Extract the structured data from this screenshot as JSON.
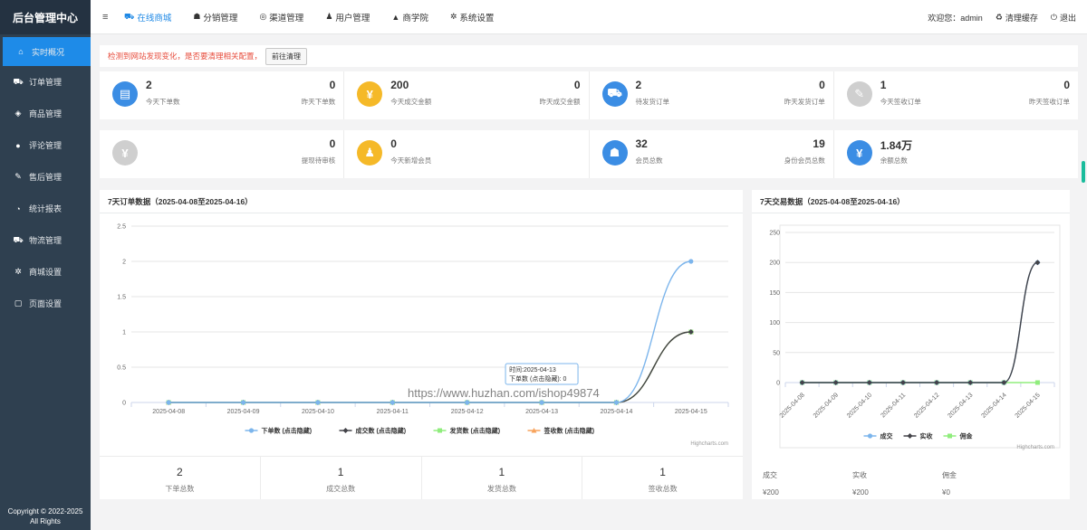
{
  "brand": "后台管理中心",
  "sidebar": {
    "items": [
      {
        "label": "实时概况",
        "icon": "home-icon",
        "glyph": "⌂",
        "active": true
      },
      {
        "label": "订单管理",
        "icon": "cart-icon",
        "glyph": "⛟",
        "active": false
      },
      {
        "label": "商品管理",
        "icon": "gift-icon",
        "glyph": "◈",
        "active": false
      },
      {
        "label": "评论管理",
        "icon": "comment-icon",
        "glyph": "●",
        "active": false
      },
      {
        "label": "售后管理",
        "icon": "gavel-icon",
        "glyph": "✎",
        "active": false
      },
      {
        "label": "统计报表",
        "icon": "pie-chart-icon",
        "glyph": "◔",
        "active": false
      },
      {
        "label": "物流管理",
        "icon": "truck-icon",
        "glyph": "⛟",
        "active": false
      },
      {
        "label": "商城设置",
        "icon": "gear-icon",
        "glyph": "✲",
        "active": false
      },
      {
        "label": "页面设置",
        "icon": "file-icon",
        "glyph": "▢",
        "active": false
      }
    ],
    "copyright_line1": "Copyright © 2022-2025",
    "copyright_line2": "All Rights"
  },
  "topnav": {
    "menu_icon": "≡",
    "items": [
      {
        "label": "在线商城",
        "icon": "cart-icon",
        "glyph": "⛟",
        "active": true
      },
      {
        "label": "分销管理",
        "icon": "users-icon",
        "glyph": "☗",
        "active": false
      },
      {
        "label": "渠道管理",
        "icon": "wechat-icon",
        "glyph": "◎",
        "active": false
      },
      {
        "label": "用户管理",
        "icon": "user-icon",
        "glyph": "♟",
        "active": false
      },
      {
        "label": "商学院",
        "icon": "graduation-cap-icon",
        "glyph": "▲",
        "active": false
      },
      {
        "label": "系统设置",
        "icon": "gear-icon",
        "glyph": "✲",
        "active": false
      }
    ],
    "welcome": "欢迎您：admin",
    "clear_cache": "清理缓存",
    "logout": "退出"
  },
  "alert": {
    "text": "检测到网站发现变化，是否要清理相关配置，",
    "button": "前往清理"
  },
  "stats_row1": [
    {
      "icon": "file-icon",
      "glyph": "▤",
      "color": "#3b8de4",
      "value": "2",
      "label": "今天下单数",
      "value2": "0",
      "label2": "昨天下单数"
    },
    {
      "icon": "yen-icon",
      "glyph": "¥",
      "color": "#f5b928",
      "value": "200",
      "label": "今天成交金额",
      "value2": "0",
      "label2": "昨天成交金额"
    },
    {
      "icon": "truck-icon",
      "glyph": "⛟",
      "color": "#3b8de4",
      "value": "2",
      "label": "待发货订单",
      "value2": "0",
      "label2": "昨天发货订单"
    },
    {
      "icon": "gavel-icon",
      "glyph": "✎",
      "color": "#cfcfcf",
      "value": "1",
      "label": "今天签收订单",
      "value2": "0",
      "label2": "昨天签收订单"
    }
  ],
  "stats_row2": [
    {
      "icon": "yen-icon",
      "glyph": "¥",
      "color": "#cfcfcf",
      "value": "",
      "label": "",
      "value2": "0",
      "label2": "提现待审核"
    },
    {
      "icon": "user-icon",
      "glyph": "♟",
      "color": "#f5b928",
      "value": "0",
      "label": "今天新增会员",
      "value2": "",
      "label2": ""
    },
    {
      "icon": "users-icon",
      "glyph": "☗",
      "color": "#3b8de4",
      "value": "32",
      "label": "会员总数",
      "value2": "19",
      "label2": "身份会员总数"
    },
    {
      "icon": "yen-icon",
      "glyph": "¥",
      "color": "#3b8de4",
      "value": "1.84万",
      "label": "余额总数",
      "value2": "",
      "label2": ""
    }
  ],
  "orders_panel": {
    "title": "7天订单数据（2025-04-08至2025-04-16）",
    "credit": "Highcharts.com",
    "tooltip_title": "时间:2025-04-13",
    "tooltip_body": "下单数 (点击隐藏): 0",
    "summary": [
      {
        "value": "2",
        "label": "下单总数"
      },
      {
        "value": "1",
        "label": "成交总数"
      },
      {
        "value": "1",
        "label": "发货总数"
      },
      {
        "value": "1",
        "label": "签收总数"
      }
    ]
  },
  "trade_panel": {
    "title": "7天交易数据（2025-04-08至2025-04-16）",
    "credit": "Highcharts.com",
    "summary": [
      {
        "label": "成交",
        "value": "¥200"
      },
      {
        "label": "实收",
        "value": "¥200"
      },
      {
        "label": "佣金",
        "value": "¥0"
      }
    ]
  },
  "watermark": "https://www.huzhan.com/ishop49874",
  "chart_data": [
    {
      "type": "line",
      "title": "",
      "categories": [
        "2025-04-08",
        "2025-04-09",
        "2025-04-10",
        "2025-04-11",
        "2025-04-12",
        "2025-04-13",
        "2025-04-14",
        "2025-04-15"
      ],
      "ylim": [
        0,
        2.5
      ],
      "yticks": [
        "0",
        "0.5",
        "1",
        "1.5",
        "2",
        "2.5"
      ],
      "yvalues": [
        0,
        0.5,
        1,
        1.5,
        2,
        2.5
      ],
      "grid": true,
      "legend_position": "bottom",
      "series": [
        {
          "name": "下单数 (点击隐藏)",
          "color": "#7cb5ec",
          "marker": "circle",
          "values": [
            0,
            0,
            0,
            0,
            0,
            0,
            0,
            2
          ]
        },
        {
          "name": "成交数 (点击隐藏)",
          "color": "#434348",
          "marker": "diamond",
          "values": [
            0,
            0,
            0,
            0,
            0,
            0,
            0,
            1
          ]
        },
        {
          "name": "发货数 (点击隐藏)",
          "color": "#90ed7d",
          "marker": "square",
          "values": [
            0,
            0,
            0,
            0,
            0,
            0,
            0,
            1
          ]
        },
        {
          "name": "签收数 (点击隐藏)",
          "color": "#f7a35c",
          "marker": "triangle",
          "values": [
            0,
            0,
            0,
            0,
            0,
            0,
            0,
            1
          ]
        }
      ]
    },
    {
      "type": "line",
      "title": "",
      "categories": [
        "2025-04-08",
        "2025-04-09",
        "2025-04-10",
        "2025-04-11",
        "2025-04-12",
        "2025-04-13",
        "2025-04-14",
        "2025-04-15"
      ],
      "ylim": [
        0,
        250
      ],
      "yticks": [
        "0",
        "50",
        "100",
        "150",
        "200",
        "250"
      ],
      "yvalues": [
        0,
        50,
        100,
        150,
        200,
        250
      ],
      "grid": true,
      "legend_position": "bottom",
      "series": [
        {
          "name": "成交",
          "color": "#7cb5ec",
          "marker": "circle",
          "values": [
            0,
            0,
            0,
            0,
            0,
            0,
            0,
            200
          ]
        },
        {
          "name": "实收",
          "color": "#434348",
          "marker": "diamond",
          "values": [
            0,
            0,
            0,
            0,
            0,
            0,
            0,
            200
          ]
        },
        {
          "name": "佣金",
          "color": "#90ed7d",
          "marker": "square",
          "values": [
            0,
            0,
            0,
            0,
            0,
            0,
            0,
            0
          ]
        }
      ]
    }
  ]
}
